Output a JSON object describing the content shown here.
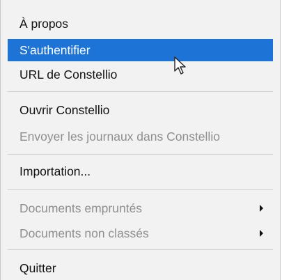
{
  "menu": {
    "items": [
      {
        "label": "À propos"
      },
      {
        "label": "S'authentifier"
      },
      {
        "label": "URL de Constellio"
      },
      {
        "label": "Ouvrir Constellio"
      },
      {
        "label": "Envoyer les journaux dans Constellio"
      },
      {
        "label": "Importation..."
      },
      {
        "label": "Documents empruntés"
      },
      {
        "label": "Documents non classés"
      },
      {
        "label": "Quitter"
      }
    ]
  },
  "icons": {
    "submenu": "chevron-right-icon",
    "cursor": "mouse-pointer-icon"
  },
  "colors": {
    "menu_background": "#f2f2f2",
    "highlight": "#1e74d6",
    "disabled_text": "#8f8f8f"
  }
}
